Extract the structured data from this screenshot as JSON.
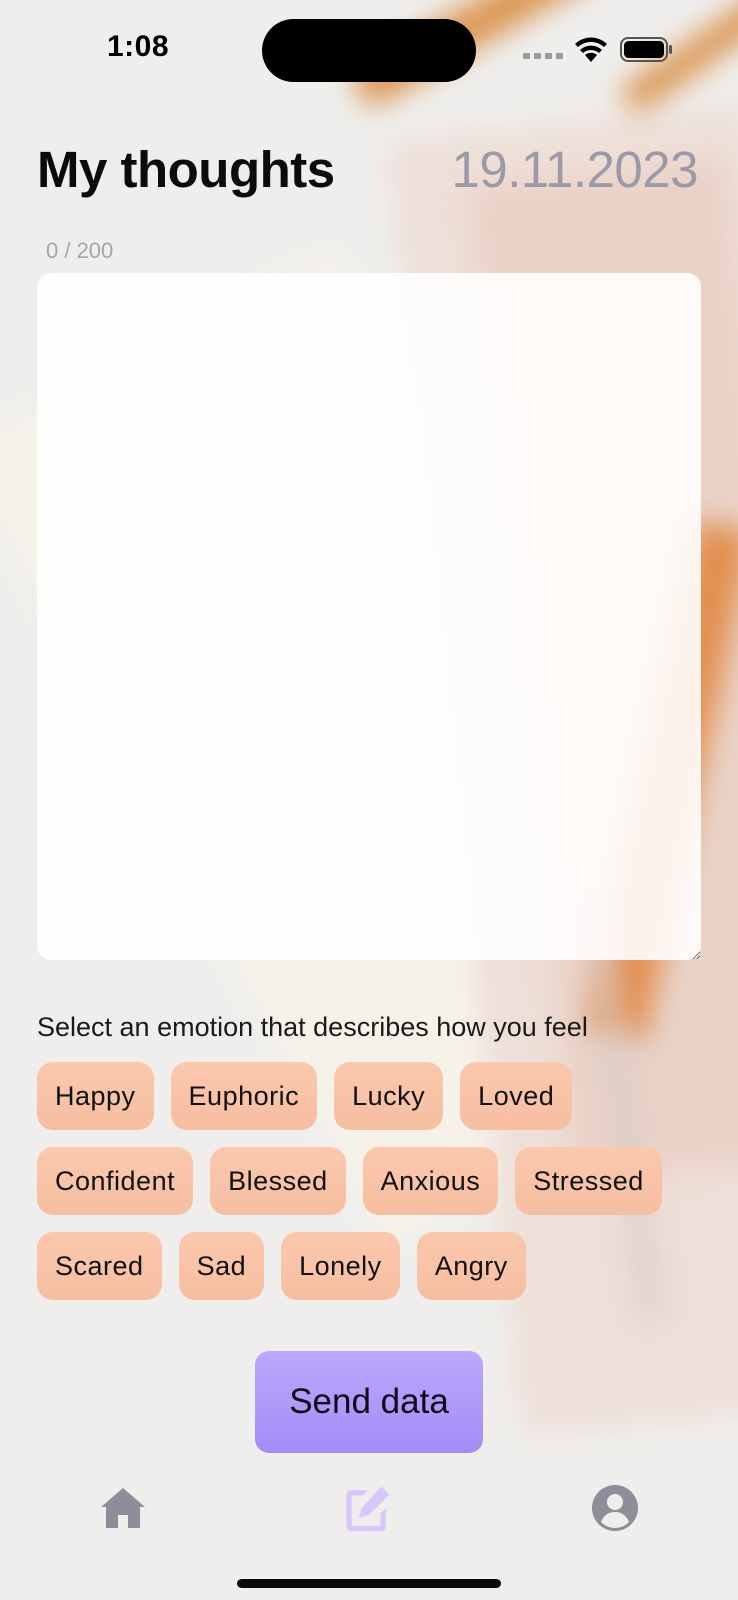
{
  "status_bar": {
    "time": "1:08"
  },
  "header": {
    "title": "My thoughts",
    "date": "19.11.2023"
  },
  "editor": {
    "char_counter": "0 / 200",
    "value": ""
  },
  "emotions": {
    "prompt": "Select an emotion that describes how you feel",
    "rows": [
      [
        "Happy",
        "Euphoric",
        "Lucky",
        "Loved"
      ],
      [
        "Confident",
        "Blessed",
        "Anxious",
        "Stressed"
      ],
      [
        "Scared",
        "Sad",
        "Lonely",
        "Angry"
      ]
    ],
    "chip_color": "#fbc8ad"
  },
  "actions": {
    "send_label": "Send data",
    "send_color": "#a993f8"
  },
  "bottom_nav": {
    "items": [
      {
        "icon": "home-icon",
        "active": false
      },
      {
        "icon": "edit-icon",
        "active": true
      },
      {
        "icon": "profile-icon",
        "active": false
      }
    ],
    "inactive_color": "#8e8d99",
    "active_color": "#d6c8fb"
  }
}
